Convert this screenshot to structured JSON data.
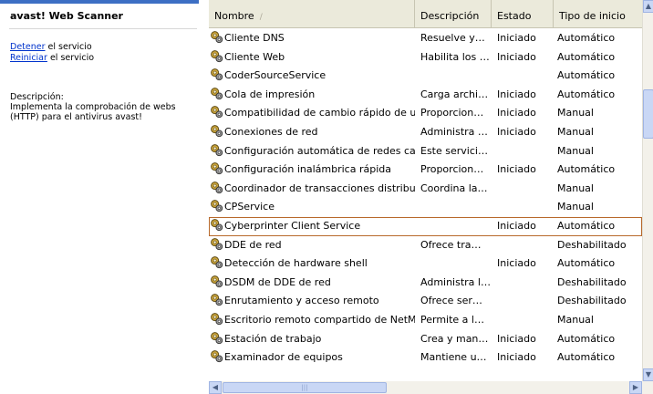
{
  "left_panel": {
    "title": "avast! Web Scanner",
    "stop_link": "Detener",
    "stop_suffix": " el servicio",
    "restart_link": "Reiniciar",
    "restart_suffix": " el servicio",
    "description_label": "Descripción:",
    "description_text": "Implementa la comprobación de webs (HTTP) para el antivirus avast!"
  },
  "columns": {
    "name": "Nombre",
    "description": "Descripción",
    "status": "Estado",
    "startup": "Tipo de inicio"
  },
  "icons": {
    "service": "gear-service-icon",
    "sort": "sort-up-icon"
  },
  "rows": [
    {
      "name": "Cliente DNS",
      "description": "Resuelve y…",
      "status": "Iniciado",
      "startup": "Automático"
    },
    {
      "name": "Cliente Web",
      "description": "Habilita los …",
      "status": "Iniciado",
      "startup": "Automático"
    },
    {
      "name": "CoderSourceService",
      "description": "",
      "status": "",
      "startup": "Automático"
    },
    {
      "name": "Cola de impresión",
      "description": "Carga archi…",
      "status": "Iniciado",
      "startup": "Automático"
    },
    {
      "name": "Compatibilidad de cambio rápido de us…",
      "description": "Proporcion…",
      "status": "Iniciado",
      "startup": "Manual"
    },
    {
      "name": "Conexiones de red",
      "description": "Administra …",
      "status": "Iniciado",
      "startup": "Manual"
    },
    {
      "name": "Configuración automática de redes ca…",
      "description": "Este servici…",
      "status": "",
      "startup": "Manual"
    },
    {
      "name": "Configuración inalámbrica rápida",
      "description": "Proporcion…",
      "status": "Iniciado",
      "startup": "Automático"
    },
    {
      "name": "Coordinador de transacciones distribui…",
      "description": "Coordina la…",
      "status": "",
      "startup": "Manual"
    },
    {
      "name": "CPService",
      "description": "",
      "status": "",
      "startup": "Manual"
    },
    {
      "name": "Cyberprinter Client Service",
      "description": "",
      "status": "Iniciado",
      "startup": "Automático",
      "selected": true
    },
    {
      "name": "DDE de red",
      "description": "Ofrece tra…",
      "status": "",
      "startup": "Deshabilitado"
    },
    {
      "name": "Detección de hardware shell",
      "description": "",
      "status": "Iniciado",
      "startup": "Automático"
    },
    {
      "name": "DSDM de DDE de red",
      "description": "Administra l…",
      "status": "",
      "startup": "Deshabilitado"
    },
    {
      "name": "Enrutamiento y acceso remoto",
      "description": "Ofrece ser…",
      "status": "",
      "startup": "Deshabilitado"
    },
    {
      "name": "Escritorio remoto compartido de NetMe…",
      "description": "Permite a l…",
      "status": "",
      "startup": "Manual"
    },
    {
      "name": "Estación de trabajo",
      "description": "Crea y man…",
      "status": "Iniciado",
      "startup": "Automático"
    },
    {
      "name": "Examinador de equipos",
      "description": "Mantiene u…",
      "status": "Iniciado",
      "startup": "Automático"
    }
  ]
}
